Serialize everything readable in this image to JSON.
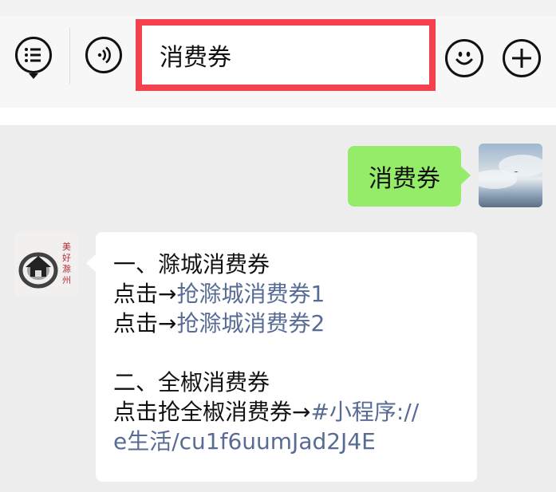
{
  "toolbar": {
    "search_value": "消费券",
    "icons": [
      "menu-icon",
      "voice-icon",
      "emoji-icon",
      "plus-icon"
    ],
    "highlight_color": "#f4414d"
  },
  "messages": {
    "sent": {
      "text": "消费券",
      "bubble_color": "#95ec69"
    },
    "reply": {
      "section1_title": "一、滁城消费券",
      "line1_prefix": "点击→",
      "line1_link": "抢滁城消费券1",
      "line2_prefix": "点击→",
      "line2_link": "抢滁城消费券2",
      "section2_title": "二、全椒消费券",
      "line3_prefix": "点击抢全椒消费券→",
      "line3_link_part1": "#小程序://",
      "line3_link_part2": "e生活/cu1f6uumJad2J4E",
      "link_color": "#576b95"
    },
    "avatar_left_text": "美好滁州"
  }
}
